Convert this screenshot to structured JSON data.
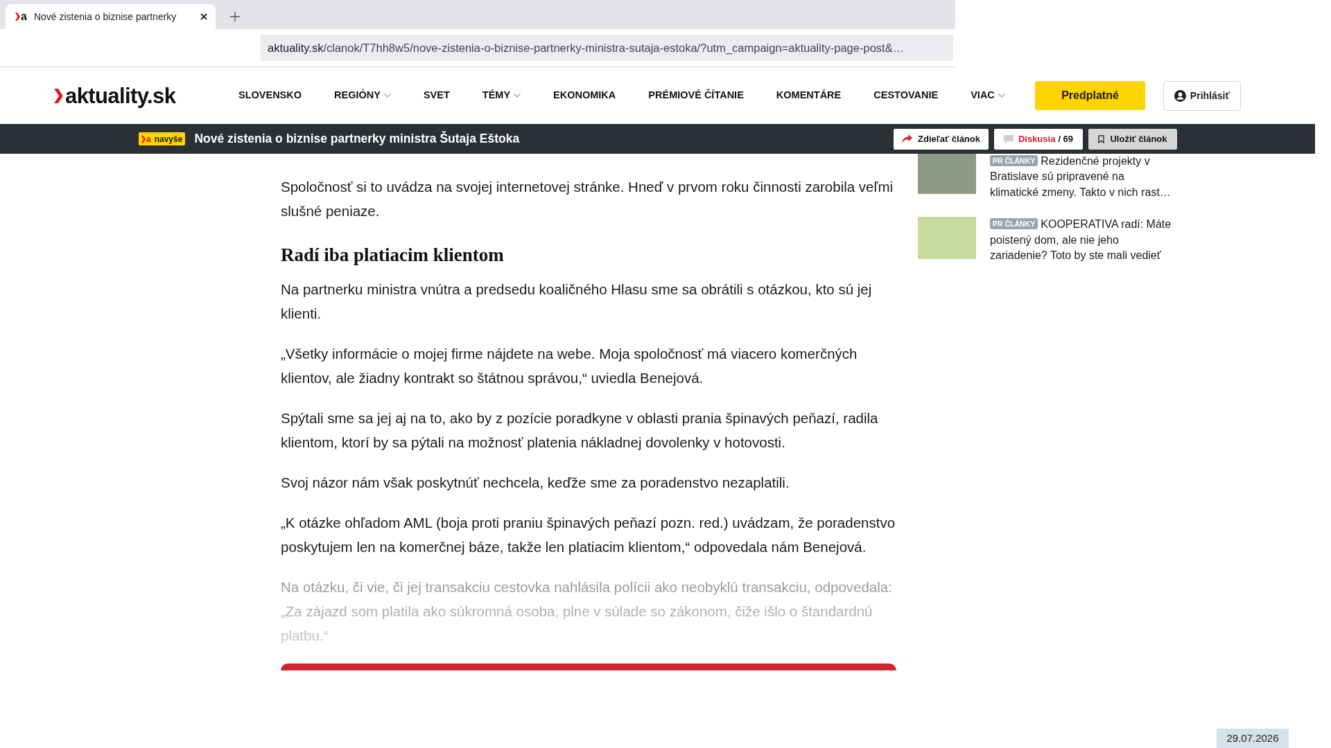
{
  "browser": {
    "tab": {
      "favicon_letter": "a",
      "title": "Nové zistenia o biznise partnerky",
      "selected": true
    },
    "address": {
      "domain": "aktuality.sk",
      "path": "/clanok/T7hh8w5/nove-zistenia-o-biznise-partnerky-ministra-sutaja-estoka/?utm_campaign=aktuality-page-post&…"
    }
  },
  "header": {
    "logo": "aktuality.sk",
    "nav": [
      {
        "label": "SLOVENSKO",
        "dropdown": false
      },
      {
        "label": "REGIÓNY",
        "dropdown": true
      },
      {
        "label": "SVET",
        "dropdown": false
      },
      {
        "label": "TÉMY",
        "dropdown": true
      },
      {
        "label": "EKONOMIKA",
        "dropdown": false
      },
      {
        "label": "PRÉMIOVÉ ČÍTANIE",
        "dropdown": false
      },
      {
        "label": "KOMENTÁRE",
        "dropdown": false
      },
      {
        "label": "CESTOVANIE",
        "dropdown": false
      },
      {
        "label": "VIAC",
        "dropdown": true
      }
    ],
    "subscribe_button": "Predplatné",
    "login_button": "Prihlásiť"
  },
  "article_bar": {
    "badge": {
      "logo_letter": "a",
      "label": "navyše"
    },
    "title": "Nové zistenia o biznise partnerky ministra Šutaja Eštoka",
    "actions": [
      {
        "kind": "share",
        "label": "Zdieľať článok"
      },
      {
        "kind": "discussion",
        "label": "Diskusia",
        "count": "/ 69"
      },
      {
        "kind": "save",
        "label": "Uložiť článok"
      }
    ]
  },
  "article": {
    "blocks": [
      {
        "kind": "paragraph",
        "faded": false,
        "text": "Spoločnosť si to uvádza na svojej internetovej stránke. Hneď v prvom roku činnosti zarobila veľmi slušné peniaze."
      },
      {
        "kind": "heading",
        "faded": false,
        "text": "Radí iba platiacim klientom"
      },
      {
        "kind": "paragraph",
        "faded": false,
        "text": "Na partnerku ministra vnútra a predsedu koaličného Hlasu sme sa obrátili s otázkou, kto sú jej klienti."
      },
      {
        "kind": "paragraph",
        "faded": false,
        "text": "„Všetky informácie o mojej firme nájdete na webe. Moja spoločnosť má viacero komerčných klientov, ale žiadny kontrakt so štátnou správou,“ uviedla Benejová."
      },
      {
        "kind": "paragraph",
        "faded": false,
        "text": "Spýtali sme sa jej aj na to, ako by z pozície poradkyne v oblasti prania špinavých peňazí, radila klientom, ktorí by sa pýtali na možnosť platenia nákladnej dovolenky v hotovosti."
      },
      {
        "kind": "paragraph",
        "faded": false,
        "text": "Svoj názor nám však poskytnúť nechcela, keďže sme za poradenstvo nezaplatili."
      },
      {
        "kind": "paragraph",
        "faded": false,
        "text": "„K otázke ohľadom AML (boja proti praniu špinavých peňazí pozn. red.) uvádzam, že poradenstvo poskytujem len na komerčnej báze, takže len platiacim klientom,“ odpovedala nám Benejová."
      },
      {
        "kind": "paragraph",
        "faded": true,
        "text": "Na otázku, či vie, či jej transakciu cestovka nahlásila polícii ako neobyklú transakciu, odpovedala: „Za zájazd som platila ako súkromná osoba, plne v súlade so zákonom, čiže išlo o štandardnú platbu.“"
      }
    ]
  },
  "sidebar": {
    "items": [
      {
        "badge": "PR ČLÁNKY",
        "title": "Rezidenčné projekty v Bratislave sú pripravené na klimatické zmeny. Takto v nich rast…"
      },
      {
        "badge": "PR ČLÁNKY",
        "title": "KOOPERATIVA radí: Máte poistený dom, ale nie jeho zariadenie? Toto by ste mali vedieť"
      }
    ]
  },
  "date": "29.07.2026"
}
